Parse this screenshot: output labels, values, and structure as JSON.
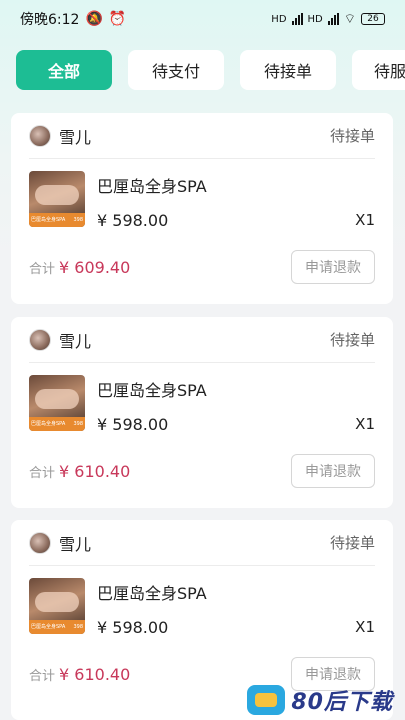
{
  "status_bar": {
    "time": "傍晚6:12",
    "net1": "HD",
    "net2": "HD",
    "battery": "26"
  },
  "tabs": [
    {
      "label": "全部",
      "active": true
    },
    {
      "label": "待支付",
      "active": false
    },
    {
      "label": "待接单",
      "active": false
    },
    {
      "label": "待服",
      "active": false
    }
  ],
  "orders": [
    {
      "user": "雪儿",
      "status": "待接单",
      "item_title": "巴厘岛全身SPA",
      "price": "¥ 598.00",
      "qty": "X1",
      "total_label": "合计",
      "total": "¥ 609.40",
      "refund_label": "申请退款",
      "thumb_caption": "巴厘岛全身SPA",
      "thumb_price": "398"
    },
    {
      "user": "雪儿",
      "status": "待接单",
      "item_title": "巴厘岛全身SPA",
      "price": "¥ 598.00",
      "qty": "X1",
      "total_label": "合计",
      "total": "¥ 610.40",
      "refund_label": "申请退款",
      "thumb_caption": "巴厘岛全身SPA",
      "thumb_price": "398"
    },
    {
      "user": "雪儿",
      "status": "待接单",
      "item_title": "巴厘岛全身SPA",
      "price": "¥ 598.00",
      "qty": "X1",
      "total_label": "合计",
      "total": "¥ 610.40",
      "refund_label": "申请退款",
      "thumb_caption": "巴厘岛全身SPA",
      "thumb_price": "398"
    }
  ],
  "watermark": {
    "text": "80后下载"
  },
  "colors": {
    "accent": "#1dbd94",
    "price": "#c8385a"
  }
}
